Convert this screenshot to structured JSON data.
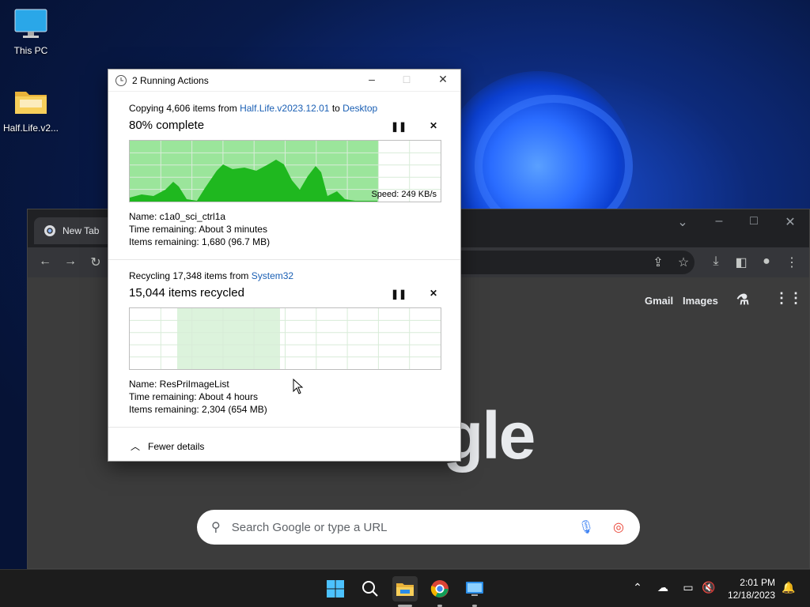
{
  "desktop": {
    "icons": [
      {
        "label": "This PC",
        "icon": "monitor-icon"
      },
      {
        "label": "Half.Life.v2...",
        "icon": "folder-icon"
      }
    ]
  },
  "chrome": {
    "tab_label": "New Tab",
    "links": {
      "gmail": "Gmail",
      "images": "Images"
    },
    "logo_text": "gle",
    "search_placeholder": "Search Google or type a URL"
  },
  "dialog": {
    "title": "2 Running Actions",
    "copy": {
      "header_prefix": "Copying 4,606 items from ",
      "source": "Half.Life.v2023.12.01",
      "header_mid": " to ",
      "destination": "Desktop",
      "status": "80% complete",
      "progress": 0.8,
      "speed": "Speed: 249 KB/s",
      "name": "Name:  c1a0_sci_ctrl1a",
      "time_remaining": "Time remaining:  About 3 minutes",
      "items_remaining": "Items remaining:  1,680 (96.7 MB)"
    },
    "recycle": {
      "header_prefix": "Recycling 17,348 items from ",
      "source": "System32",
      "status": "15,044 items recycled",
      "name": "Name:  ResPriImageList",
      "time_remaining": "Time remaining:  About 4 hours",
      "items_remaining": "Items remaining:  2,304 (654 MB)"
    },
    "fewer_details": "Fewer details"
  },
  "taskbar": {
    "time": "2:01 PM",
    "date": "12/18/2023"
  },
  "colors": {
    "progress_fill": "#9be59b",
    "graph_fill": "#1fb81f",
    "link": "#1a5fb4"
  }
}
